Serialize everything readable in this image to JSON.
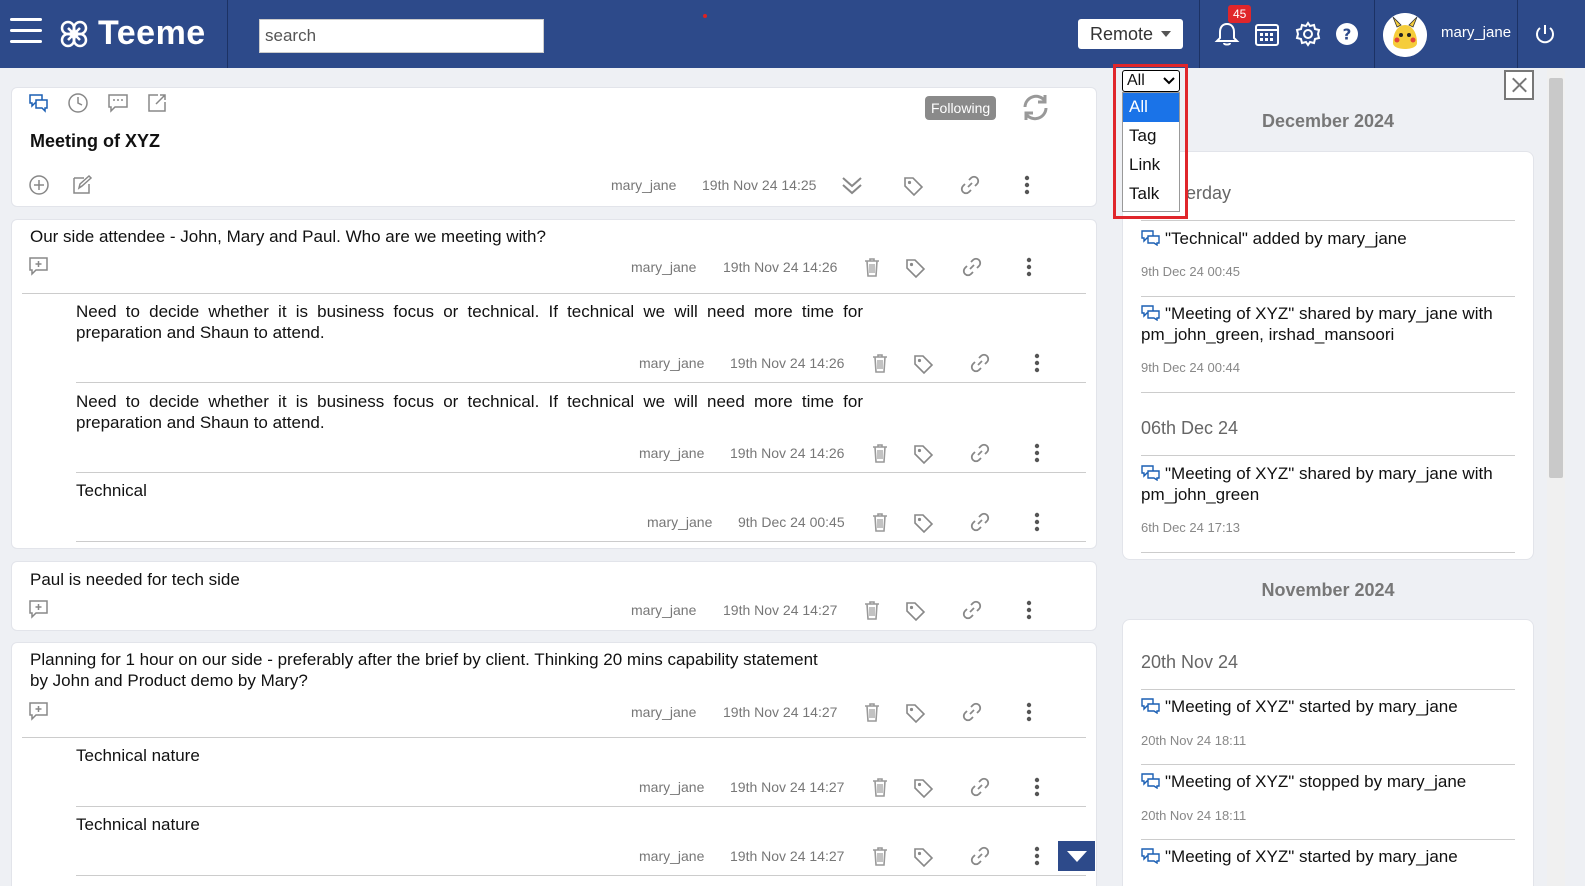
{
  "header": {
    "logo_text": "Teeme",
    "search_placeholder": "search",
    "mode_label": "Remote",
    "notifications_count": "45",
    "username": "mary_jane"
  },
  "topic": {
    "title": "Meeting of XYZ",
    "following_label": "Following",
    "author": "mary_jane",
    "date": "19th Nov 24 14:25"
  },
  "posts": [
    {
      "text": "Our side attendee - John, Mary and Paul. Who are we meeting with?",
      "author": "mary_jane",
      "date": "19th Nov 24 14:26",
      "replies": [
        {
          "text": "Need to decide whether it is business focus or technical. If technical we will need more time for preparation and Shaun to attend.",
          "author": "mary_jane",
          "date": "19th Nov 24 14:26"
        },
        {
          "text": "Need to decide whether it is business focus or technical. If technical we will need more time for preparation and Shaun to attend.",
          "author": "mary_jane",
          "date": "19th Nov 24 14:26"
        },
        {
          "text": "Technical",
          "author": "mary_jane",
          "date": "9th Dec 24 00:45"
        }
      ]
    },
    {
      "text": "Paul is needed for tech side",
      "author": "mary_jane",
      "date": "19th Nov 24 14:27",
      "replies": []
    },
    {
      "text": "Planning for 1 hour on our side - preferably after the brief by client. Thinking 20 mins capability statement by John and Product demo by Mary?",
      "author": "mary_jane",
      "date": "19th Nov 24 14:27",
      "replies": [
        {
          "text": "Technical nature",
          "author": "mary_jane",
          "date": "19th Nov 24 14:27"
        },
        {
          "text": "Technical nature",
          "author": "mary_jane",
          "date": "19th Nov 24 14:27"
        }
      ]
    }
  ],
  "activity": {
    "filter": {
      "selected": "All",
      "options": [
        "All",
        "Tag",
        "Link",
        "Talk"
      ]
    },
    "months": [
      {
        "label": "December 2024",
        "days": [
          {
            "label": "Yesterday",
            "visible_label": "erday",
            "events": [
              {
                "text": "\"Technical\" added by mary_jane",
                "time": "9th Dec 24 00:45"
              },
              {
                "text": "\"Meeting of XYZ\" shared by mary_jane with pm_john_green, irshad_mansoori",
                "time": "9th Dec 24 00:44"
              }
            ]
          },
          {
            "label": "06th Dec 24",
            "events": [
              {
                "text": "\"Meeting of XYZ\" shared by mary_jane with pm_john_green",
                "time": "6th Dec 24 17:13"
              }
            ]
          }
        ]
      },
      {
        "label": "November 2024",
        "days": [
          {
            "label": "20th Nov 24",
            "events": [
              {
                "text": "\"Meeting of XYZ\" started by mary_jane",
                "time": "20th Nov 24 18:11"
              },
              {
                "text": "\"Meeting of XYZ\" stopped by mary_jane",
                "time": "20th Nov 24 18:11"
              },
              {
                "text": "\"Meeting of XYZ\" started by mary_jane",
                "time": ""
              }
            ]
          }
        ]
      }
    ]
  },
  "colors": {
    "header_bg": "#2d4a8a",
    "badge": "#e0262b",
    "highlight": "#e0262b",
    "selected_option": "#1a73e8"
  }
}
